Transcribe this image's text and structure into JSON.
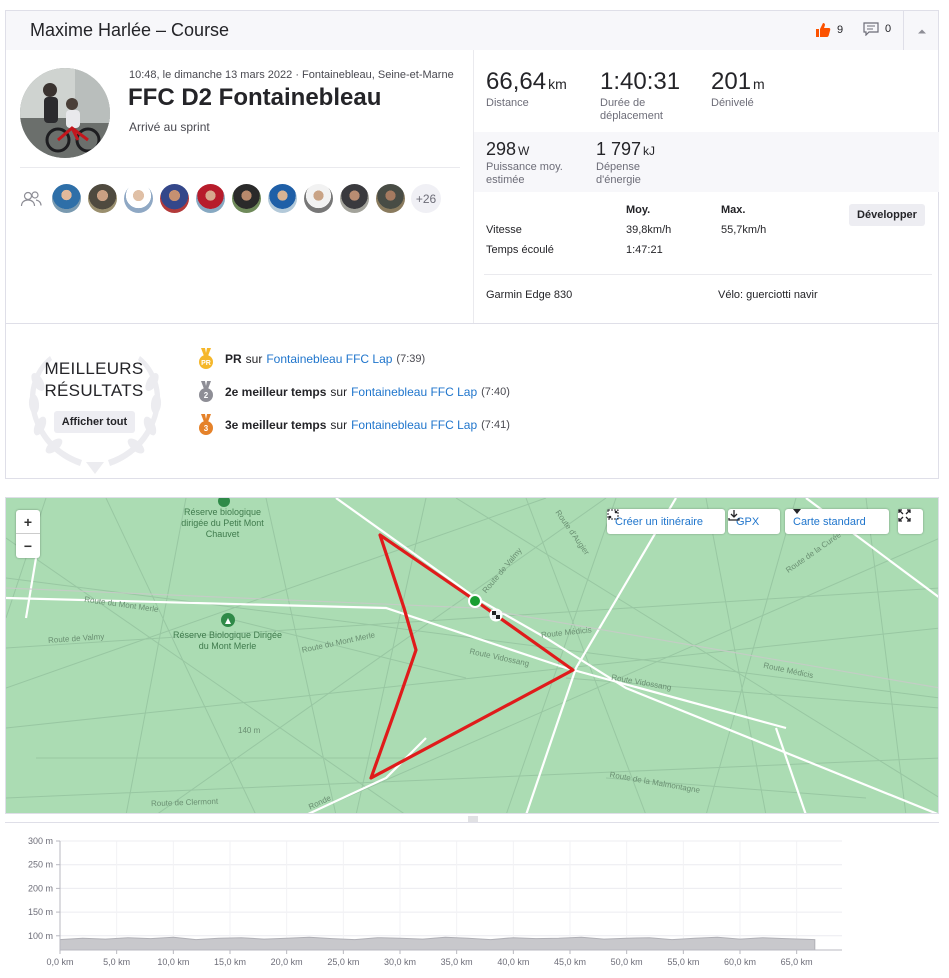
{
  "header": {
    "title": "Maxime Harlée – Course",
    "kudos_count": "9",
    "comment_count": "0"
  },
  "activity": {
    "meta": "10:48, le dimanche 13 mars 2022 · Fontainebleau, Seine-et-Marne",
    "title": "FFC D2 Fontainebleau",
    "description": "Arrivé au sprint",
    "more_athletes": "+26"
  },
  "stats": {
    "distance": {
      "value": "66,64",
      "unit": "km",
      "label": "Distance"
    },
    "moving_time": {
      "value": "1:40:31",
      "label": "Durée de déplacement"
    },
    "elevation": {
      "value": "201",
      "unit": "m",
      "label": "Dénivelé"
    },
    "power": {
      "value": "298",
      "unit": "W",
      "label": "Puissance moy. estimée"
    },
    "energy": {
      "value": "1 797",
      "unit": "kJ",
      "label": "Dépense d'énergie"
    },
    "table": {
      "col_avg": "Moy.",
      "col_max": "Max.",
      "speed_label": "Vitesse",
      "speed_avg": "39,8km/h",
      "speed_max": "55,7km/h",
      "elapsed_label": "Temps écoulé",
      "elapsed_avg": "1:47:21"
    },
    "expand_button": "Développer",
    "device": "Garmin Edge 830",
    "bike": "Vélo: guerciotti navir"
  },
  "achievements": {
    "title_line1": "MEILLEURS",
    "title_line2": "RÉSULTATS",
    "show_all": "Afficher tout",
    "items": [
      {
        "rank": "PR",
        "prefix": "PR",
        "sur": "sur",
        "segment": "Fontainebleau FFC Lap",
        "time": "(7:39)",
        "medal_color": "#f5b72a"
      },
      {
        "rank": "2",
        "prefix": "2e meilleur temps",
        "sur": "sur",
        "segment": "Fontainebleau FFC Lap",
        "time": "(7:40)",
        "medal_color": "#8e8e96"
      },
      {
        "rank": "3",
        "prefix": "3e meilleur temps",
        "sur": "sur",
        "segment": "Fontainebleau FFC Lap",
        "time": "(7:41)",
        "medal_color": "#e5822a"
      }
    ]
  },
  "map": {
    "zoom_in": "+",
    "zoom_out": "−",
    "create_route": "Créer un itinéraire",
    "gpx": "GPX",
    "map_type": "Carte standard",
    "places": [
      "Réserve biologique dirigée du Petit Mont Chauvet",
      "Réserve Biologique Dirigée du Mont Merle"
    ],
    "roads": [
      "Route du Mont Merle",
      "Route de Valmy",
      "Route du Mont Merle",
      "Route de Valmy",
      "Route d'Augier",
      "Route Médicis",
      "Route Vidossang",
      "Route Vidossang",
      "Route Médicis",
      "Route de la Curée",
      "Route de la Malmontagne",
      "Route de Clermont",
      "Ronde",
      "140 m"
    ],
    "route_color": "#e01b1b"
  },
  "chart_data": {
    "type": "area",
    "x_tick_labels": [
      "0,0 km",
      "5,0 km",
      "10,0 km",
      "15,0 km",
      "20,0 km",
      "25,0 km",
      "30,0 km",
      "35,0 km",
      "40,0 km",
      "45,0 km",
      "50,0 km",
      "55,0 km",
      "60,0 km",
      "65,0 km"
    ],
    "y_tick_labels": [
      "300 m",
      "250 m",
      "200 m",
      "150 m",
      "100 m"
    ],
    "xlim": [
      0,
      69
    ],
    "ylim": [
      70,
      300
    ],
    "x": [
      0,
      2,
      4,
      6,
      8,
      10,
      12,
      14,
      16,
      18,
      20,
      22,
      24,
      26,
      28,
      30,
      32,
      34,
      36,
      38,
      40,
      42,
      44,
      46,
      48,
      50,
      52,
      54,
      56,
      58,
      60,
      62,
      64,
      66.6
    ],
    "elevation": [
      92,
      95,
      93,
      96,
      94,
      97,
      92,
      95,
      96,
      93,
      95,
      97,
      94,
      92,
      96,
      95,
      93,
      97,
      95,
      92,
      96,
      94,
      95,
      97,
      93,
      95,
      96,
      92,
      95,
      97,
      93,
      96,
      94,
      92
    ],
    "fill_color": "#c8c8cc"
  }
}
